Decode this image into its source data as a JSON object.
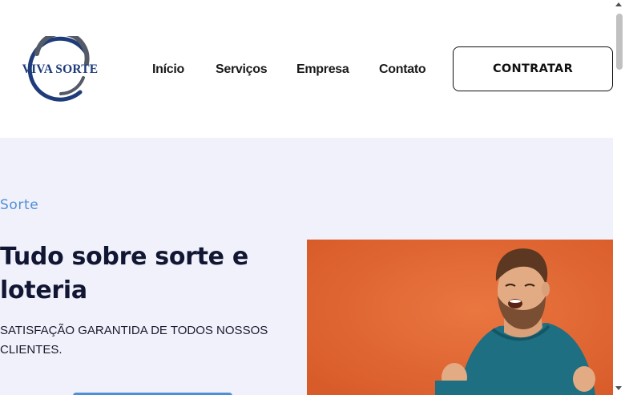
{
  "brand": {
    "logo_text": "VIVA SORTE",
    "colors": {
      "navy": "#1e3c7a",
      "gray": "#555b66"
    }
  },
  "nav": {
    "items": [
      {
        "label": "Início"
      },
      {
        "label": "Serviços"
      },
      {
        "label": "Empresa"
      },
      {
        "label": "Contato"
      }
    ],
    "cta_label": "CONTRATAR"
  },
  "hero": {
    "eyebrow": "Sorte",
    "headline": "Tudo sobre sorte e loteria",
    "subtitle": "SATISFAÇÃO GARANTIDA DE TODOS NOSSOS CLIENTES.",
    "image_semantic": "smiling-man-orange-background",
    "colors": {
      "background": "#f1f1fb",
      "accent": "#4f8fd6",
      "photo_bg": "#e56a35"
    }
  },
  "scrollbar": {
    "thumb_color": "#c1c1c1"
  }
}
